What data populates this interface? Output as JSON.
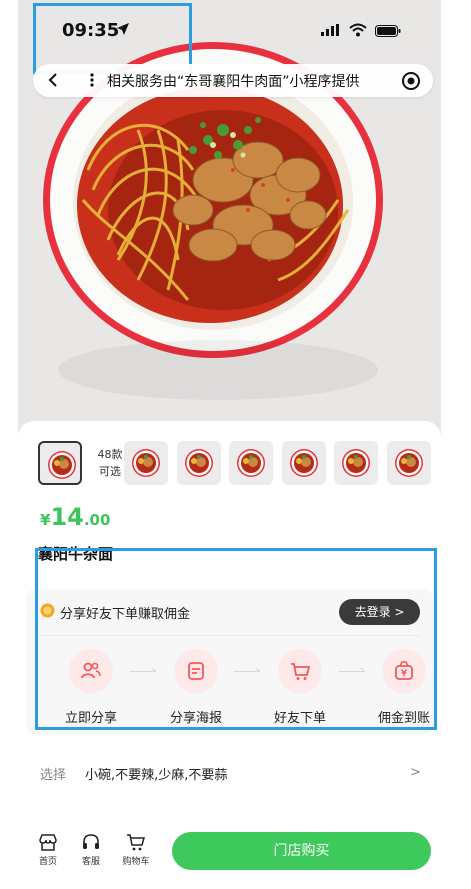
{
  "status_bar": {
    "time": "09:35"
  },
  "capsule": {
    "text": "相关服务由“东哥襄阳牛肉面”小程序提供"
  },
  "product": {
    "variant_count": "48款",
    "variant_count_sub": "可选",
    "price_currency": "¥",
    "price_integer": "14",
    "price_decimal": ".00",
    "name": "襄阳牛杂面"
  },
  "share": {
    "title": "分享好友下单赚取佣金",
    "login_button": "去登录 >",
    "steps": [
      {
        "label": "立即分享",
        "icon": "share-people-icon"
      },
      {
        "label": "分享海报",
        "icon": "poster-icon"
      },
      {
        "label": "好友下单",
        "icon": "cart-icon"
      },
      {
        "label": "佣金到账",
        "icon": "money-bag-icon"
      }
    ]
  },
  "options": {
    "key": "选择",
    "value": "小碗,不要辣,少麻,不要蒜"
  },
  "bottom_bar": {
    "tabs": [
      {
        "label": "首页",
        "icon": "shop-icon"
      },
      {
        "label": "客服",
        "icon": "headset-icon"
      },
      {
        "label": "购物车",
        "icon": "cart-icon"
      }
    ],
    "buy_button": "门店购买"
  },
  "colors": {
    "accent_green": "#3ec95c",
    "highlight_blue": "#2b9ee3",
    "pale_red": "#fde9e9",
    "icon_red": "#f2595b"
  }
}
